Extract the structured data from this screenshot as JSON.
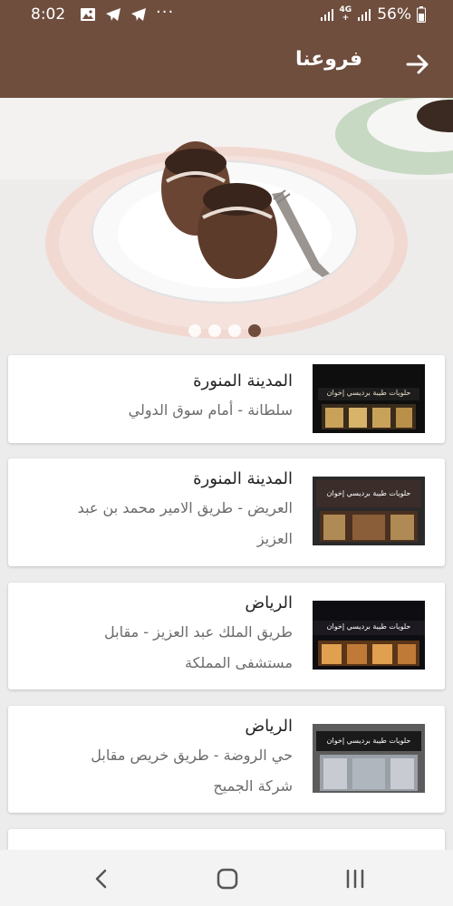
{
  "status_bar": {
    "time": "8:02",
    "left_icons": [
      "image-icon",
      "telegram-icon",
      "telegram-icon"
    ],
    "more": "···",
    "network_label_top": "4G",
    "network_label_bottom": "+",
    "battery": "56%"
  },
  "app_bar": {
    "title": "فروعنا",
    "back_icon": "arrow-right-icon"
  },
  "carousel": {
    "page_count": 4,
    "active_index": 3
  },
  "branches": [
    {
      "city": "المدينة المنورة",
      "address_lines": [
        "سلطانة - أمام سوق الدولي"
      ],
      "sign": "حلويات طيبة برديسي إخوان"
    },
    {
      "city": "المدينة المنورة",
      "address_lines": [
        "العريض - طريق الامير محمد بن عبد",
        "العزيز"
      ],
      "sign": "حلويات طيبة برديسي إخوان"
    },
    {
      "city": "الرياض",
      "address_lines": [
        "طريق الملك عبد العزيز - مقابل",
        "مستشفى المملكة"
      ],
      "sign": "حلويات طيبة برديسي إخوان"
    },
    {
      "city": "الرياض",
      "address_lines": [
        "حي الروضة - طريق خريص مقابل",
        "شركة الجميح"
      ],
      "sign": "حلويات طيبة برديسي إخوان"
    }
  ],
  "nav_bar": {
    "buttons": [
      "back-nav-icon",
      "home-nav-icon",
      "recents-nav-icon"
    ]
  },
  "colors": {
    "primary": "#6f4e3e",
    "background": "#ececec"
  }
}
